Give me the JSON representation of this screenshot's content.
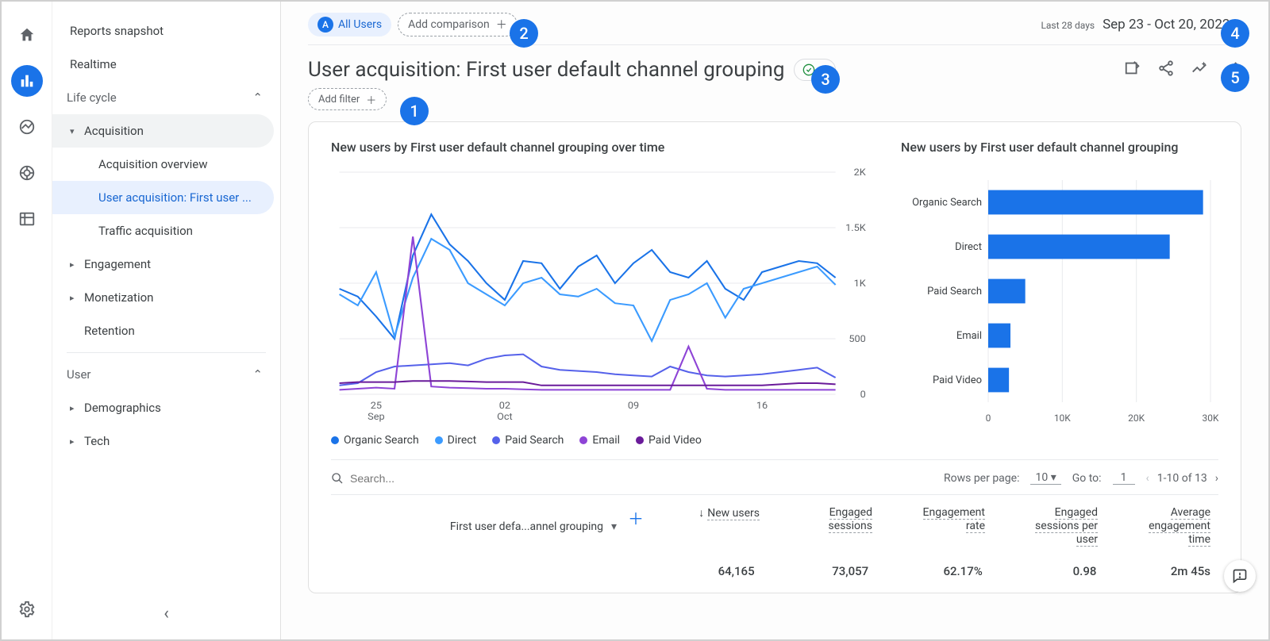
{
  "rail": {
    "items": [
      "home",
      "reports",
      "explore",
      "advertising",
      "configure",
      "admin"
    ]
  },
  "sidebar": {
    "items": [
      {
        "label": "Reports snapshot"
      },
      {
        "label": "Realtime"
      }
    ],
    "life_cycle": {
      "label": "Life cycle",
      "acquisition": {
        "label": "Acquisition",
        "children": [
          "Acquisition overview",
          "User acquisition: First user ...",
          "Traffic acquisition"
        ]
      },
      "engagement": {
        "label": "Engagement"
      },
      "monetization": {
        "label": "Monetization"
      },
      "retention": {
        "label": "Retention"
      }
    },
    "user": {
      "label": "User",
      "demographics": {
        "label": "Demographics"
      },
      "tech": {
        "label": "Tech"
      }
    }
  },
  "topbar": {
    "all_users_badge": "A",
    "all_users": "All Users",
    "add_comparison": "Add comparison",
    "date_hint": "Last 28 days",
    "date_range": "Sep 23 - Oct 20, 2022"
  },
  "title": "User acquisition: First user default channel grouping",
  "filter": {
    "add_filter": "Add filter"
  },
  "chart_titles": {
    "line": "New users by First user default channel grouping over time",
    "bar": "New users by First user default channel grouping"
  },
  "badges": {
    "b1": "1",
    "b2": "2",
    "b3": "3",
    "b4": "4",
    "b5": "5"
  },
  "chart_data": [
    {
      "type": "line",
      "title": "New users by First user default channel grouping over time",
      "xlabel": "",
      "ylabel": "",
      "y_ticks": [
        0,
        500,
        1000,
        1500,
        2000
      ],
      "x_ticks": [
        "25 Sep",
        "02 Oct",
        "09",
        "16"
      ],
      "x": [
        0,
        1,
        2,
        3,
        4,
        5,
        6,
        7,
        8,
        9,
        10,
        11,
        12,
        13,
        14,
        15,
        16,
        17,
        18,
        19,
        20,
        21,
        22,
        23,
        24,
        25,
        26,
        27
      ],
      "series": [
        {
          "name": "Organic Search",
          "color": "#1a73e8",
          "values": [
            950,
            880,
            700,
            500,
            1250,
            1620,
            1350,
            1200,
            1000,
            850,
            1200,
            1180,
            950,
            1150,
            1250,
            1000,
            1180,
            1300,
            1100,
            1050,
            1200,
            950,
            850,
            1100,
            1150,
            1200,
            1180,
            1050
          ]
        },
        {
          "name": "Direct",
          "color": "#3b9bff",
          "values": [
            900,
            800,
            1100,
            520,
            1050,
            1400,
            1300,
            1000,
            900,
            800,
            1000,
            1050,
            900,
            880,
            950,
            820,
            800,
            480,
            850,
            900,
            1000,
            690,
            950,
            1000,
            1050,
            1100,
            1150,
            985
          ]
        },
        {
          "name": "Paid Search",
          "color": "#5561ea",
          "values": [
            80,
            100,
            200,
            250,
            260,
            270,
            280,
            260,
            320,
            350,
            360,
            250,
            220,
            210,
            200,
            180,
            170,
            160,
            250,
            200,
            170,
            160,
            170,
            180,
            200,
            220,
            240,
            150
          ]
        },
        {
          "name": "Email",
          "color": "#8e44d6",
          "values": [
            40,
            50,
            60,
            50,
            1420,
            70,
            60,
            55,
            50,
            50,
            45,
            40,
            40,
            40,
            40,
            40,
            40,
            40,
            40,
            430,
            50,
            40,
            40,
            40,
            40,
            40,
            40,
            40
          ]
        },
        {
          "name": "Paid Video",
          "color": "#6a1b9a",
          "values": [
            100,
            110,
            110,
            110,
            120,
            120,
            120,
            115,
            110,
            110,
            110,
            80,
            80,
            80,
            80,
            80,
            80,
            80,
            80,
            80,
            80,
            80,
            80,
            80,
            90,
            100,
            100,
            90
          ]
        }
      ],
      "ylim": [
        0,
        2000
      ]
    },
    {
      "type": "bar",
      "orientation": "horizontal",
      "title": "New users by First user default channel grouping",
      "categories": [
        "Organic Search",
        "Direct",
        "Paid Search",
        "Email",
        "Paid Video"
      ],
      "values": [
        29000,
        24500,
        5000,
        3000,
        2800
      ],
      "xlim": [
        0,
        30000
      ],
      "x_ticks": [
        0,
        10000,
        20000,
        30000
      ],
      "x_tick_labels": [
        "0",
        "10K",
        "20K",
        "30K"
      ],
      "color": "#1a73e8"
    }
  ],
  "legend": [
    {
      "name": "Organic Search",
      "color": "#1a73e8"
    },
    {
      "name": "Direct",
      "color": "#3b9bff"
    },
    {
      "name": "Paid Search",
      "color": "#5561ea"
    },
    {
      "name": "Email",
      "color": "#8e44d6"
    },
    {
      "name": "Paid Video",
      "color": "#6a1b9a"
    }
  ],
  "table_toolbar": {
    "search_placeholder": "Search...",
    "rows_per_page_label": "Rows per page:",
    "rows_per_page_value": "10",
    "goto_label": "Go to:",
    "goto_value": "1",
    "range": "1-10 of 13"
  },
  "table": {
    "dimension_label": "First user defa...annel grouping",
    "columns": [
      {
        "line1": "New users",
        "sorted": true
      },
      {
        "line1": "Engaged",
        "line2": "sessions"
      },
      {
        "line1": "Engagement",
        "line2": "rate"
      },
      {
        "line1": "Engaged",
        "line2": "sessions per",
        "line3": "user"
      },
      {
        "line1": "Average",
        "line2": "engagement",
        "line3": "time"
      }
    ],
    "totals": [
      "64,165",
      "73,057",
      "62.17%",
      "0.98",
      "2m 45s"
    ]
  }
}
